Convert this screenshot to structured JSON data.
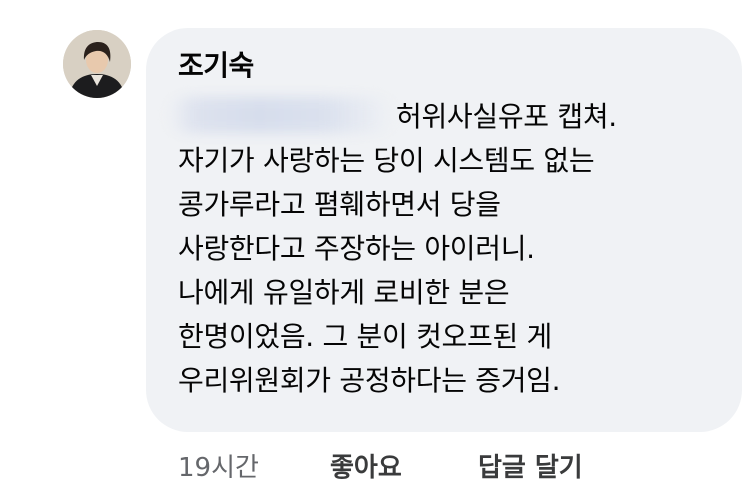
{
  "comment": {
    "author": "조기숙",
    "lines": [
      "허위사실유포 캡쳐.",
      "자기가 사랑하는 당이 시스템도 없는",
      "콩가루라고 폄훼하면서 당을",
      "사랑한다고 주장하는 아이러니.",
      "나에게 유일하게 로비한 분은",
      "한명이었음. 그 분이 컷오프된 게",
      "우리위원회가 공정하다는 증거임."
    ]
  },
  "actions": {
    "timestamp": "19시간",
    "like_label": "좋아요",
    "reply_label": "답글 달기"
  },
  "colors": {
    "bubble": "#f0f2f5",
    "text": "#050505",
    "muted": "#65676b",
    "action": "#3a3b3c"
  }
}
